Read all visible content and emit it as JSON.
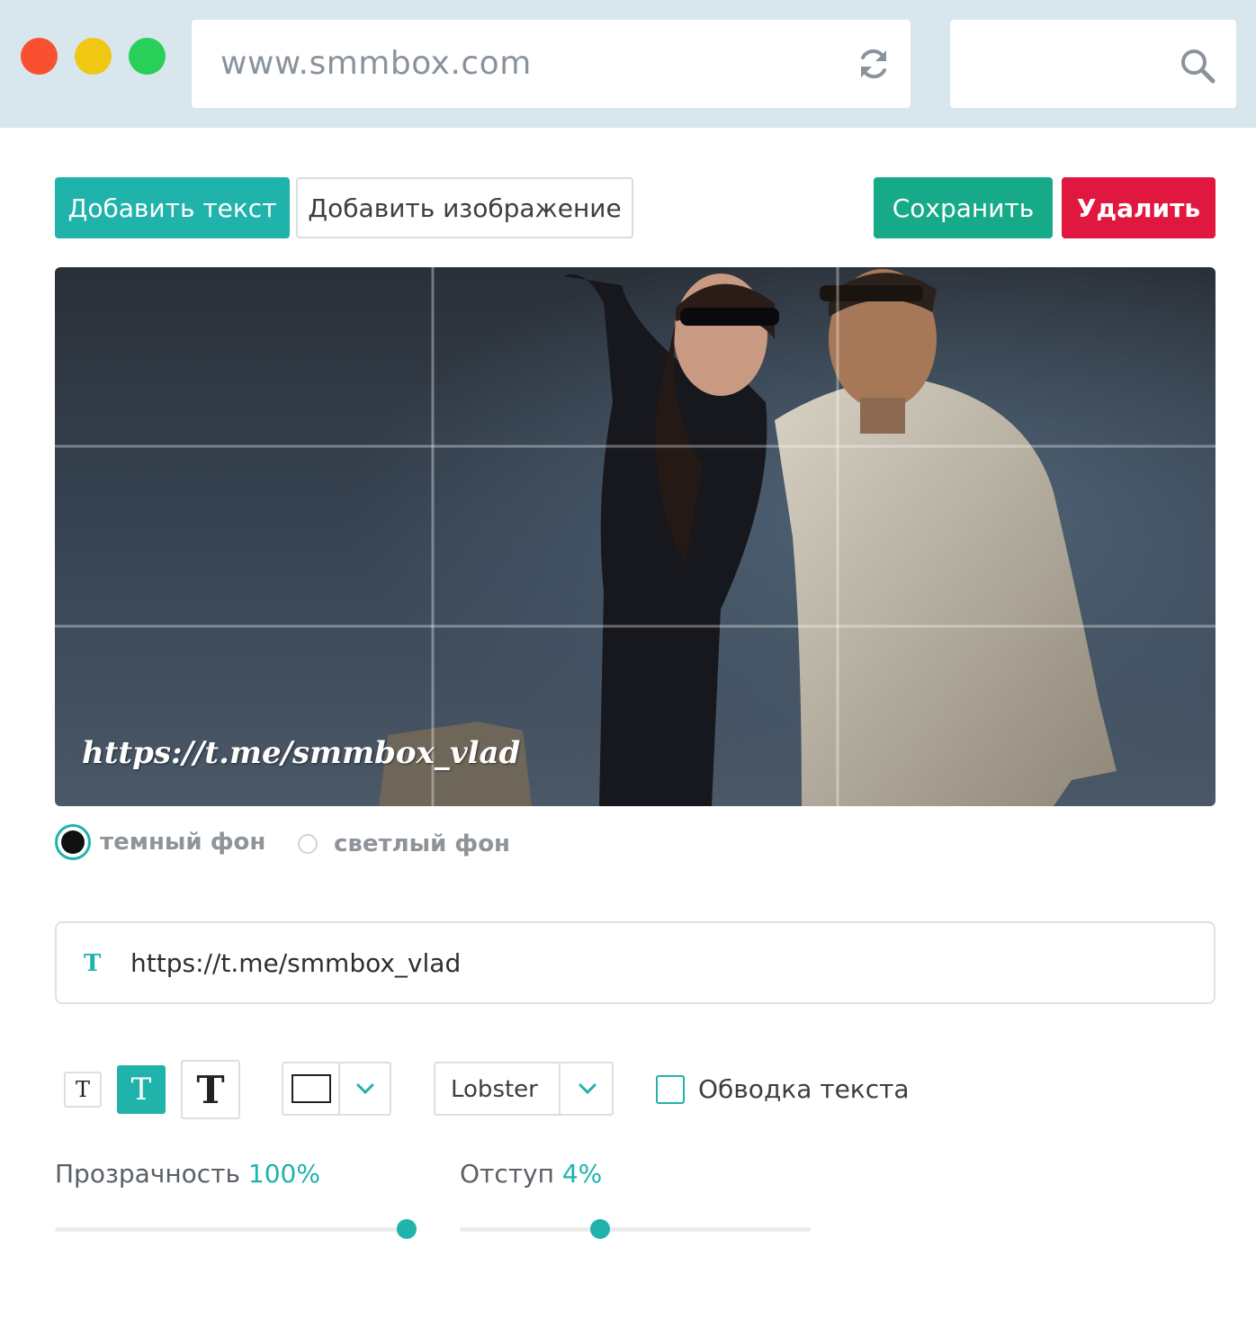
{
  "browser": {
    "url": "www.smmbox.com"
  },
  "toolbar": {
    "add_text": "Добавить текст",
    "add_image": "Добавить изображение",
    "save": "Сохранить",
    "delete": "Удалить"
  },
  "canvas": {
    "overlay_text": "https://t.me/smmbox_vlad"
  },
  "background_options": {
    "dark": "темный фон",
    "light": "светлый фон",
    "selected": "dark"
  },
  "text_input": {
    "icon": "text-cursor-icon",
    "icon_glyph": "T",
    "value": "https://t.me/smmbox_vlad"
  },
  "text_size_buttons": [
    {
      "name": "small",
      "glyph": "T"
    },
    {
      "name": "medium",
      "glyph": "T",
      "active": true
    },
    {
      "name": "large",
      "glyph": "T"
    }
  ],
  "color_dropdown": {
    "selected_color": "#ffffff"
  },
  "font_dropdown": {
    "value": "Lobster"
  },
  "outline": {
    "label": "Обводка текста",
    "checked": false
  },
  "opacity": {
    "label": "Прозрачность",
    "value_text": "100%",
    "value": 1.0
  },
  "padding": {
    "label": "Отступ",
    "value_text": "4%",
    "value": 0.4
  },
  "colors": {
    "accent": "#1fb3ac",
    "save": "#17aa88",
    "delete": "#e0173e"
  }
}
